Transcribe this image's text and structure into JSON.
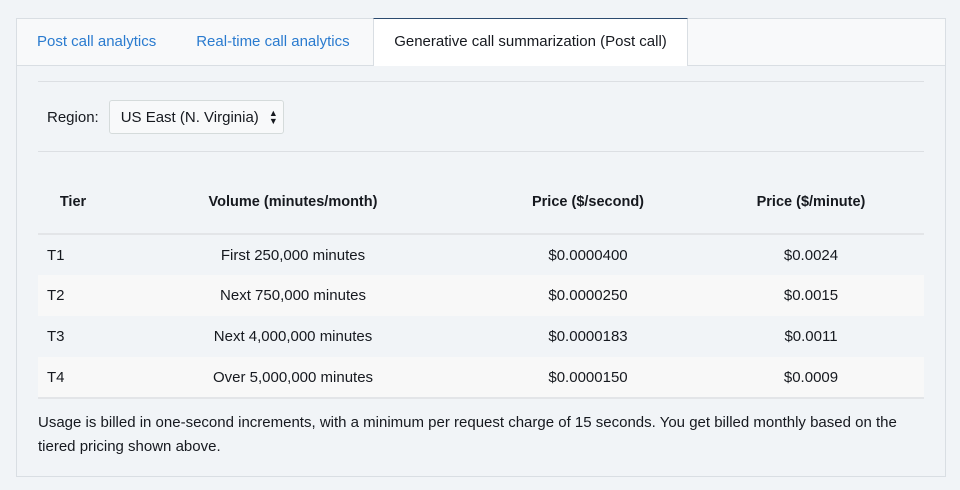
{
  "tabs": [
    "Post call analytics",
    "Real-time call analytics",
    "Generative call summarization (Post call)"
  ],
  "region": {
    "label": "Region:",
    "value": "US East (N. Virginia)"
  },
  "table": {
    "headers": [
      "Tier",
      "Volume (minutes/month)",
      "Price ($/second)",
      "Price ($/minute)"
    ],
    "rows": [
      [
        "T1",
        "First 250,000 minutes",
        "$0.0000400",
        "$0.0024"
      ],
      [
        "T2",
        "Next 750,000 minutes",
        "$0.0000250",
        "$0.0015"
      ],
      [
        "T3",
        "Next 4,000,000 minutes",
        "$0.0000183",
        "$0.0011"
      ],
      [
        "T4",
        "Over 5,000,000 minutes",
        "$0.0000150",
        "$0.0009"
      ]
    ]
  },
  "note": "Usage is billed in one-second increments, with a minimum per request charge of 15 seconds. You get billed monthly based on the tiered pricing shown above."
}
